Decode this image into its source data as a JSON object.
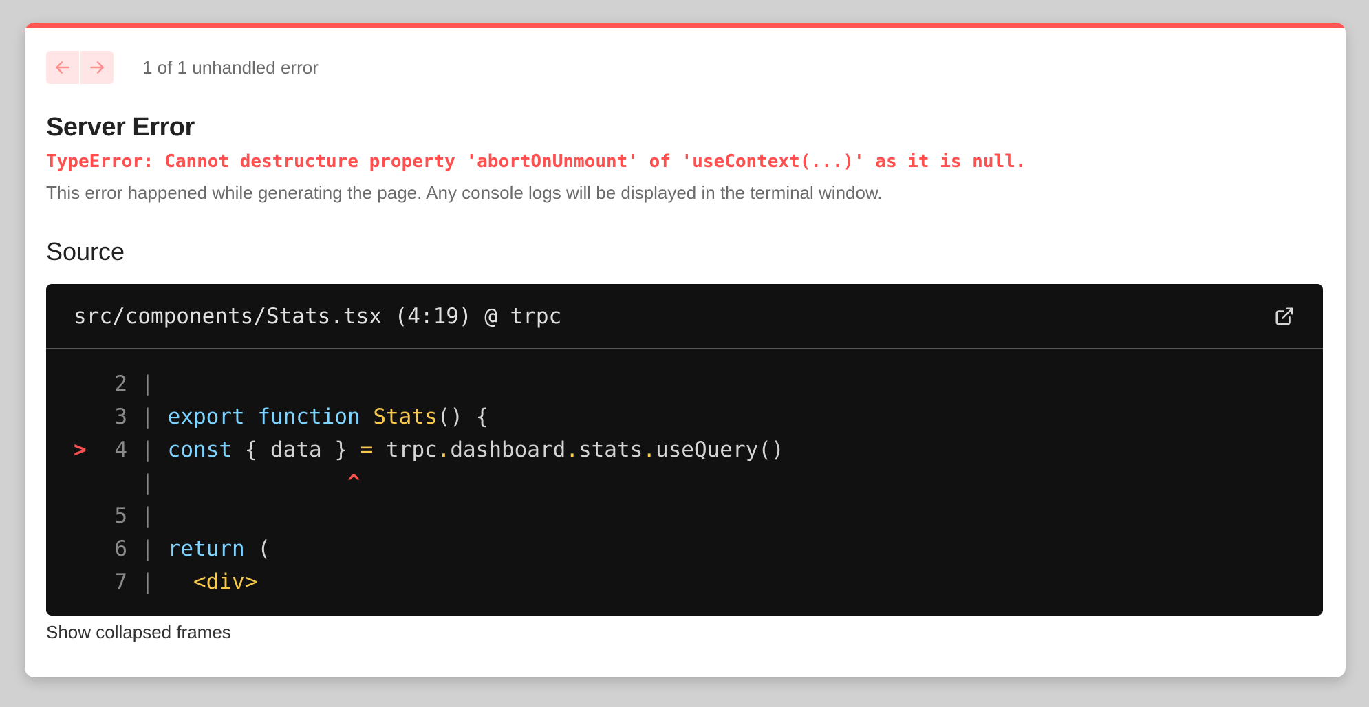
{
  "colors": {
    "accent": "#ff5555",
    "error_text": "#ff4f4f",
    "code_bg": "#111111",
    "keyword": "#7fd3ff",
    "function": "#f6c84b"
  },
  "nav": {
    "prev_icon": "arrow-left-icon",
    "next_icon": "arrow-right-icon",
    "counter": "1 of 1 unhandled error"
  },
  "error": {
    "title": "Server Error",
    "message": "TypeError: Cannot destructure property 'abortOnUnmount' of 'useContext(...)' as it is null.",
    "description": "This error happened while generating the page. Any console logs will be displayed in the terminal window."
  },
  "source": {
    "section_title": "Source",
    "file_path": "src/components/Stats.tsx (4:19) @ trpc",
    "open_icon": "external-link-icon",
    "lines": {
      "l2": {
        "no": "2"
      },
      "l3": {
        "no": "3",
        "kw": "export function",
        "fn": "Stats",
        "rest": "() {"
      },
      "l4": {
        "marker": ">",
        "no": "4",
        "kw": "const",
        "p1": "{ data }",
        "op": "=",
        "p2": "trpc",
        "p3": "dashboard",
        "p4": "stats",
        "p5": "useQuery()",
        "dot": "."
      },
      "caret": {
        "symbol": "^"
      },
      "l5": {
        "no": "5"
      },
      "l6": {
        "no": "6",
        "kw": "return",
        "rest": "("
      },
      "l7": {
        "no": "7",
        "tag": "<div>"
      }
    },
    "pipe": "|"
  },
  "footer": {
    "show_collapsed": "Show collapsed frames"
  }
}
